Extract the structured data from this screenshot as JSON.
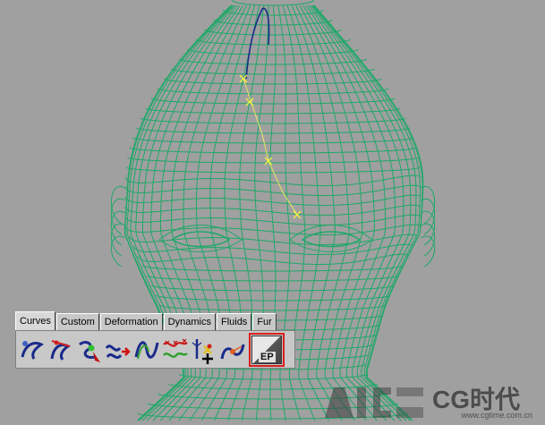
{
  "shelf": {
    "tabs": [
      {
        "label": "Curves",
        "active": true
      },
      {
        "label": "Custom"
      },
      {
        "label": "Deformation"
      },
      {
        "label": "Dynamics"
      },
      {
        "label": "Fluids"
      },
      {
        "label": "Fur"
      }
    ],
    "tools": [
      {
        "icon": "cv-curve-tool-icon"
      },
      {
        "icon": "ep-curve-sketch-icon"
      },
      {
        "icon": "pencil-curve-tool-icon"
      },
      {
        "icon": "rebuild-curve-icon"
      },
      {
        "icon": "smooth-curve-icon"
      },
      {
        "icon": "offset-curve-icon"
      },
      {
        "icon": "add-points-tool-icon"
      },
      {
        "icon": "curve-editing-tool-icon"
      },
      {
        "icon": "ep-curve-tool-icon",
        "label": "EP",
        "selected": true
      }
    ]
  },
  "colors": {
    "viewport_bg": "#a0a0a0",
    "wireframe": "#1ea868",
    "curve": "#1a2a8a",
    "ep_points": "#ffff33",
    "selection_border": "#d81f1f"
  },
  "watermark": {
    "brand": "CG时代",
    "url": "www.cgtime.com.cn"
  }
}
